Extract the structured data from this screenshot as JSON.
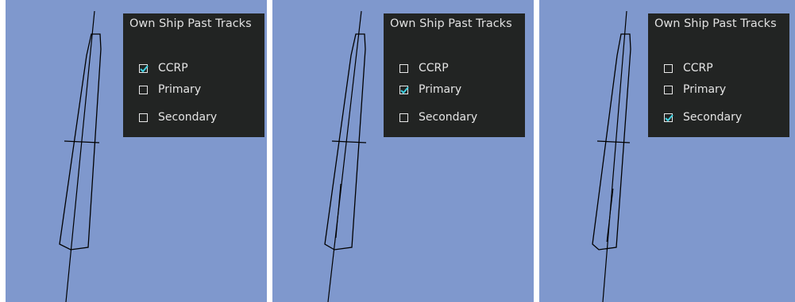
{
  "colors": {
    "background": "#7f98cd",
    "menu_background": "#222423",
    "menu_text": "#e4e4e4",
    "check_accent": "#3fd0e0",
    "track_line": "#000000"
  },
  "panels": [
    {
      "menu": {
        "title": "Own Ship Past Tracks",
        "options": [
          {
            "label": "CCRP",
            "checked": true
          },
          {
            "label": "Primary",
            "checked": false
          },
          {
            "label": "Secondary",
            "checked": false
          }
        ]
      }
    },
    {
      "menu": {
        "title": "Own Ship Past Tracks",
        "options": [
          {
            "label": "CCRP",
            "checked": false
          },
          {
            "label": "Primary",
            "checked": true
          },
          {
            "label": "Secondary",
            "checked": false
          }
        ]
      }
    },
    {
      "menu": {
        "title": "Own Ship Past Tracks",
        "options": [
          {
            "label": "CCRP",
            "checked": false
          },
          {
            "label": "Primary",
            "checked": false
          },
          {
            "label": "Secondary",
            "checked": true
          }
        ]
      }
    }
  ]
}
